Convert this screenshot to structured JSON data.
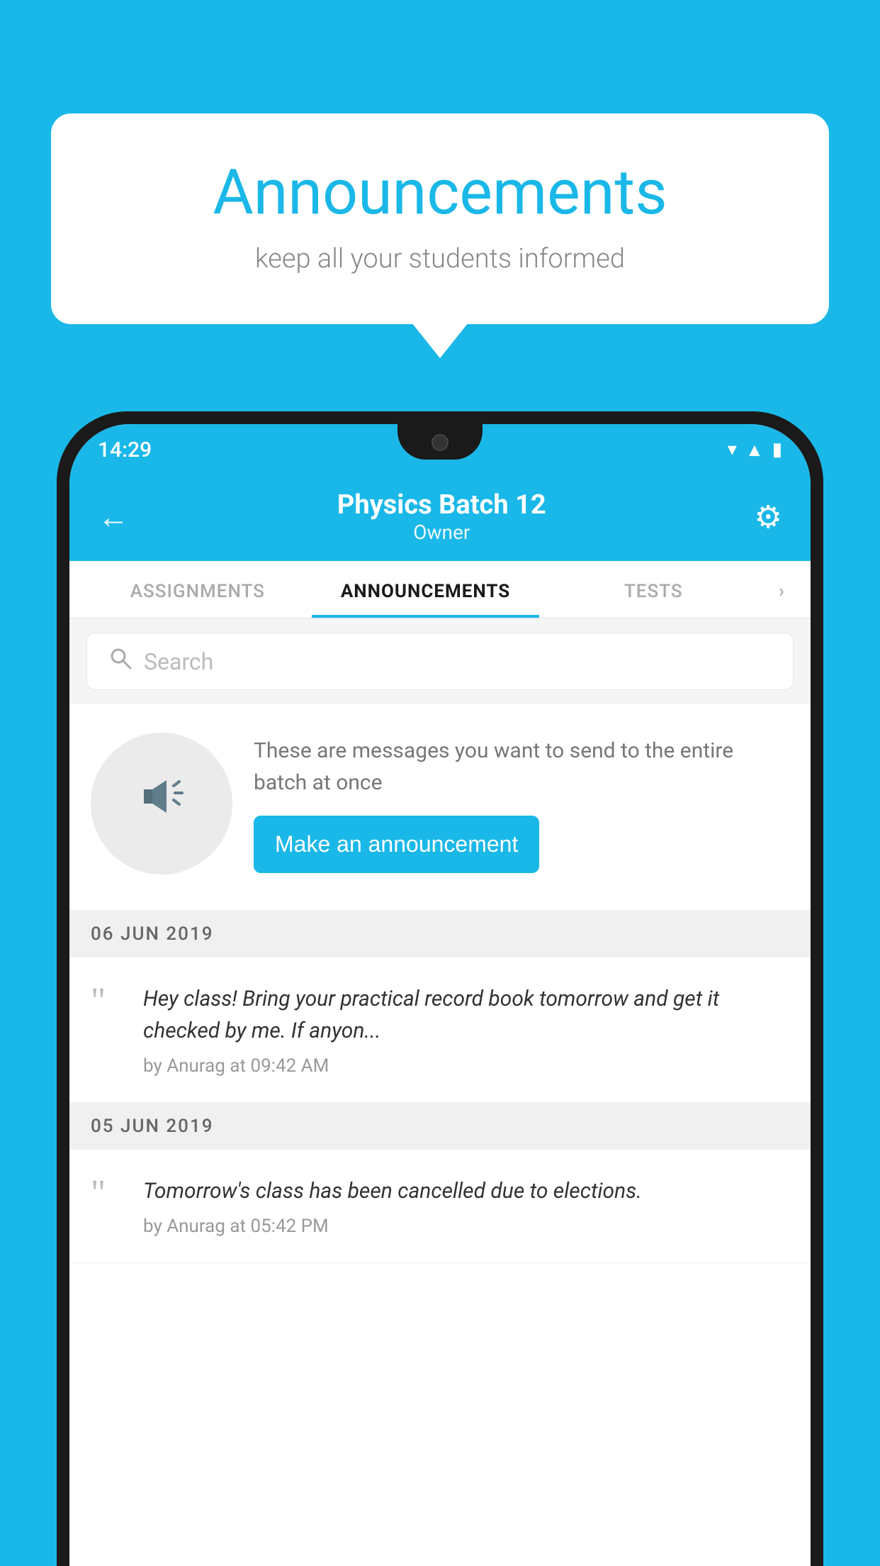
{
  "background_color": "#1ab8e8",
  "speech_bubble": {
    "title": "Announcements",
    "subtitle": "keep all your students informed"
  },
  "status_bar": {
    "time": "14:29",
    "wifi": "▾",
    "signal": "▲",
    "battery": "▮"
  },
  "header": {
    "title": "Physics Batch 12",
    "subtitle": "Owner",
    "back_label": "←",
    "gear_label": "⚙"
  },
  "tabs": [
    {
      "label": "ASSIGNMENTS",
      "active": false
    },
    {
      "label": "ANNOUNCEMENTS",
      "active": true
    },
    {
      "label": "TESTS",
      "active": false
    },
    {
      "label": "›",
      "active": false
    }
  ],
  "search": {
    "placeholder": "Search"
  },
  "promo": {
    "text": "These are messages you want to send to the entire batch at once",
    "button_label": "Make an announcement"
  },
  "announcements": [
    {
      "date": "06  JUN  2019",
      "text": "Hey class! Bring your practical record book tomorrow and get it checked by me. If anyon...",
      "meta": "by Anurag at 09:42 AM"
    },
    {
      "date": "05  JUN  2019",
      "text": "Tomorrow's class has been cancelled due to elections.",
      "meta": "by Anurag at 05:42 PM"
    }
  ]
}
